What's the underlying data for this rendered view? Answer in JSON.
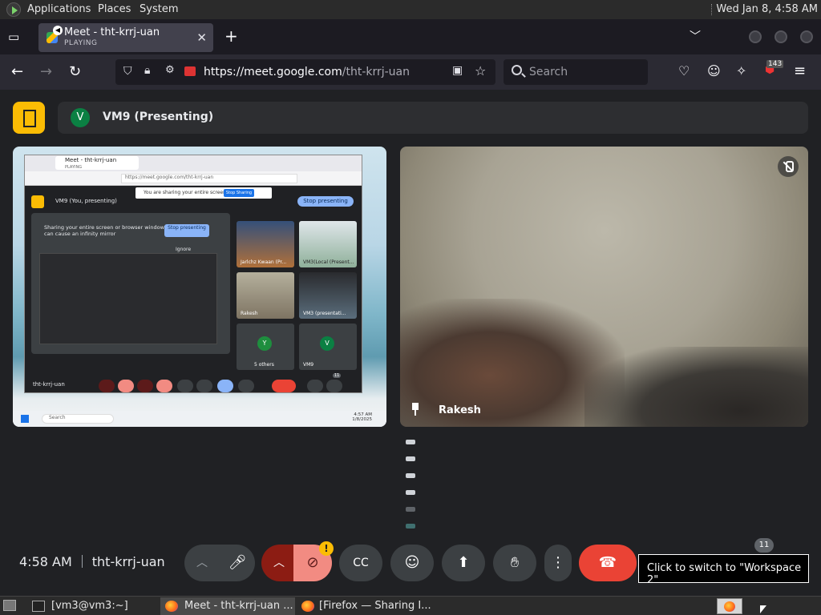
{
  "desktop": {
    "menus": [
      "Applications",
      "Places",
      "System"
    ],
    "clock": "Wed Jan  8,  4:58 AM"
  },
  "browser": {
    "tab": {
      "title": "Meet - tht-krrj-uan",
      "status": "PLAYING"
    },
    "new_tab": "+",
    "url_host": "https://meet.google.com",
    "url_path": "/tht-krrj-uan",
    "search_placeholder": "Search",
    "ext_badge": "143"
  },
  "meet": {
    "presenter_initial": "V",
    "presenter_label": "VM9 (Presenting)",
    "remote_name": "Rakesh",
    "time": "4:58 AM",
    "room": "tht-krrj-uan",
    "participant_count": "11",
    "warning_badge": "!"
  },
  "shared_screen": {
    "tab_title": "Meet - tht-krrj-uan",
    "tab_status": "PLAYING",
    "url": "https://meet.google.com/tht-krrj-uan",
    "banner_text": "You are sharing your entire screen",
    "banner_button": "Stop Sharing",
    "header": "VM9 (You, presenting)",
    "stop_button": "Stop presenting",
    "mirror_warning": "Sharing your entire screen or browser window can cause an infinity mirror",
    "stop_button2": "Stop presenting",
    "ignore": "Ignore",
    "tiles": [
      {
        "name": "Jarlchz Kwaan (Pr..."
      },
      {
        "name": "VM3(Local (Present..."
      },
      {
        "name": "Rakesh"
      },
      {
        "name": "VM3 (presentati..."
      },
      {
        "name": "5 others"
      },
      {
        "name": "VM9"
      }
    ],
    "tile_initial": "V",
    "others_initials": "Y",
    "meeting_code": "tht-krrj-uan",
    "count": "11",
    "search": "Search",
    "time": "4:57 AM",
    "date": "1/8/2025"
  },
  "tooltip": "Click to switch to \"Workspace 2\"",
  "taskbar": {
    "items": [
      "[vm3@vm3:~]",
      "Meet - tht-krrj-uan ...",
      "[Firefox — Sharing I..."
    ]
  }
}
